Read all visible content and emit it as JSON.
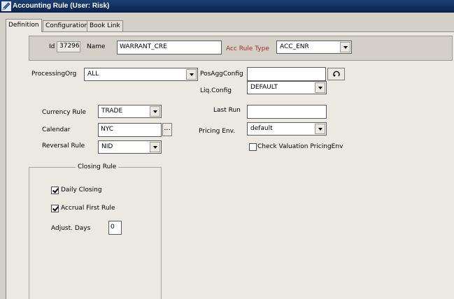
{
  "window": {
    "title": "Accounting Rule (User: Risk)"
  },
  "tabs": [
    {
      "label": "Definition",
      "active": true
    },
    {
      "label": "Configuration",
      "active": false
    },
    {
      "label": "Book Link",
      "active": false
    }
  ],
  "header": {
    "id_label": "Id",
    "id_value": "37296",
    "name_label": "Name",
    "name_value": "WARRANT_CRE",
    "rule_type_label": "Acc Rule Type",
    "rule_type_value": "ACC_ENR"
  },
  "form": {
    "processing_org_label": "ProcessingOrg",
    "processing_org_value": "ALL",
    "pos_agg_label": "PosAggConfig",
    "pos_agg_value": "",
    "liq_config_label": "Liq.Config",
    "liq_config_value": "DEFAULT",
    "currency_rule_label": "Currency Rule",
    "currency_rule_value": "TRADE",
    "last_run_label": "Last Run",
    "last_run_value": "",
    "calendar_label": "Calendar",
    "calendar_value": "NYC",
    "calendar_button": "...",
    "pricing_env_label": "Pricing Env.",
    "pricing_env_value": "default",
    "reversal_rule_label": "Reversal Rule",
    "reversal_rule_value": "NID",
    "check_valuation_label": "Check Valuation PricingEnv",
    "check_valuation_checked": false
  },
  "closing_rule": {
    "title": "Closing Rule",
    "daily_closing_label": "Daily Closing",
    "daily_closing_checked": true,
    "accrual_first_label": "Accrual First Rule",
    "accrual_first_checked": true,
    "adjust_days_label": "Adjust.  Days",
    "adjust_days_value": "0"
  },
  "icons": {
    "app": "app-pen-icon",
    "refresh": "refresh-icon"
  },
  "colors": {
    "titlebar": "#0a2452",
    "rule_type_label": "#a2282d"
  }
}
